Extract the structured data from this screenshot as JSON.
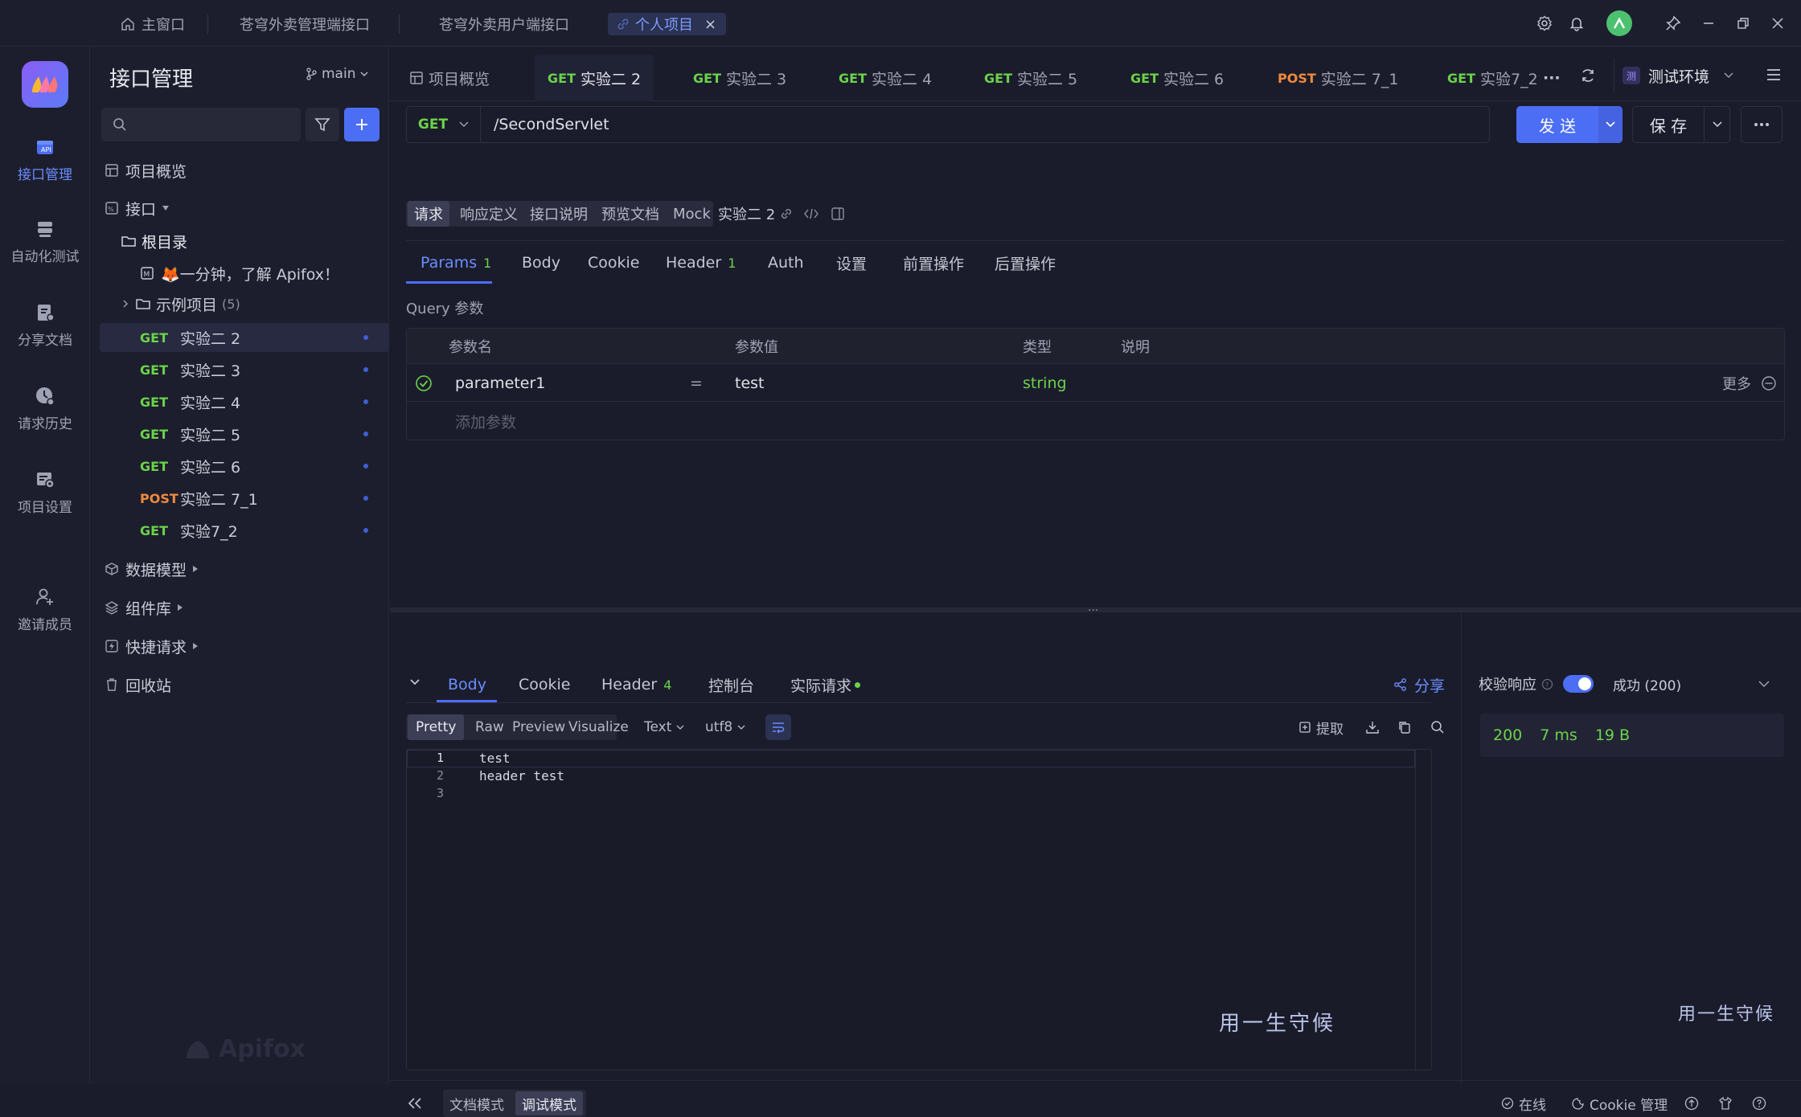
{
  "titlebar": {
    "tabs": [
      {
        "label": "主窗口"
      },
      {
        "label": "苍穹外卖管理端接口"
      },
      {
        "label": "苍穹外卖用户端接口"
      },
      {
        "label": "个人项目"
      }
    ],
    "active_tab_close": "×"
  },
  "rail": {
    "items": [
      {
        "label": "接口管理",
        "icon": "api-management-icon"
      },
      {
        "label": "自动化测试",
        "icon": "automation-icon"
      },
      {
        "label": "分享文档",
        "icon": "share-doc-icon"
      },
      {
        "label": "请求历史",
        "icon": "history-icon"
      },
      {
        "label": "项目设置",
        "icon": "project-settings-icon"
      },
      {
        "label": "邀请成员",
        "icon": "invite-member-icon"
      }
    ]
  },
  "sidebar": {
    "title": "接口管理",
    "branch": "main",
    "search_placeholder": "",
    "overview": "项目概览",
    "interfaces": "接口",
    "root": "根目录",
    "intro_doc": "🦊一分钟，了解 Apifox！",
    "example": "示例项目",
    "example_count": "(5)",
    "endpoints": [
      {
        "method": "GET",
        "name": "实验二 2"
      },
      {
        "method": "GET",
        "name": "实验二 3"
      },
      {
        "method": "GET",
        "name": "实验二 4"
      },
      {
        "method": "GET",
        "name": "实验二 5"
      },
      {
        "method": "GET",
        "name": "实验二 6"
      },
      {
        "method": "POST",
        "name": "实验二 7_1"
      },
      {
        "method": "GET",
        "name": "实验7_2"
      }
    ],
    "data_model": "数据模型",
    "components": "组件库",
    "quick_request": "快捷请求",
    "recycle": "回收站",
    "watermark": "Apifox"
  },
  "request_tabs": {
    "overview": "项目概览",
    "tabs": [
      {
        "method": "GET",
        "name": "实验二 2"
      },
      {
        "method": "GET",
        "name": "实验二 3"
      },
      {
        "method": "GET",
        "name": "实验二 4"
      },
      {
        "method": "GET",
        "name": "实验二 5"
      },
      {
        "method": "GET",
        "name": "实验二 6"
      },
      {
        "method": "POST",
        "name": "实验二 7_1"
      },
      {
        "method": "GET",
        "name": "实验7_2"
      }
    ],
    "more": "···",
    "env_badge": "测",
    "env": "测试环境"
  },
  "urlbar": {
    "method": "GET",
    "url": "/SecondServlet",
    "send": "发 送",
    "save": "保 存"
  },
  "subtabs": [
    "请求",
    "响应定义",
    "接口说明",
    "预览文档",
    "Mock"
  ],
  "endpoint_name": "实验二 2",
  "param_tabs": [
    {
      "label": "Params",
      "count": "1"
    },
    {
      "label": "Body",
      "count": ""
    },
    {
      "label": "Cookie",
      "count": ""
    },
    {
      "label": "Header",
      "count": "1"
    },
    {
      "label": "Auth",
      "count": ""
    },
    {
      "label": "设置",
      "count": ""
    },
    {
      "label": "前置操作",
      "count": ""
    },
    {
      "label": "后置操作",
      "count": ""
    }
  ],
  "query": {
    "title": "Query 参数",
    "headers": [
      "参数名",
      "参数值",
      "类型",
      "说明"
    ],
    "rows": [
      {
        "name": "parameter1",
        "eq": "=",
        "value": "test",
        "type": "string",
        "more": "更多"
      }
    ],
    "add_placeholder": "添加参数"
  },
  "response": {
    "tabs": [
      {
        "label": "Body",
        "count": ""
      },
      {
        "label": "Cookie",
        "count": ""
      },
      {
        "label": "Header",
        "count": "4"
      },
      {
        "label": "控制台",
        "count": ""
      },
      {
        "label": "实际请求",
        "count": ""
      }
    ],
    "share": "分享",
    "views": [
      "Pretty",
      "Raw",
      "Preview",
      "Visualize"
    ],
    "format": "Text",
    "encoding": "utf8",
    "extract": "提取",
    "lines": [
      {
        "n": "1",
        "text": "test"
      },
      {
        "n": "2",
        "text": "header test"
      },
      {
        "n": "3",
        "text": ""
      }
    ],
    "watermark": "用一生守候"
  },
  "validate": {
    "label": "校验响应",
    "result": "成功 (200)",
    "status": "200",
    "time": "7 ms",
    "size": "19 B",
    "watermark": "用一生守候"
  },
  "footer": {
    "doc_mode": "文档模式",
    "debug_mode": "调试模式",
    "online": "在线",
    "cookie": "Cookie 管理"
  },
  "colors": {
    "accent": "#4c6ef5",
    "get": "#6bd34a",
    "post": "#f08a3c",
    "bg": "#1b1c2b"
  }
}
